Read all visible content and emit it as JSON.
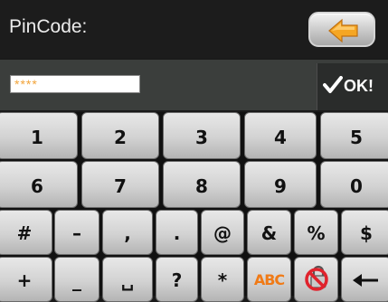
{
  "header": {
    "title": "PinCode:"
  },
  "input": {
    "value": "****"
  },
  "ok_button": {
    "label": "OK!"
  },
  "keyboard": {
    "row1": [
      "1",
      "2",
      "3",
      "4",
      "5"
    ],
    "row2": [
      "6",
      "7",
      "8",
      "9",
      "0"
    ],
    "row3": [
      "#",
      "–",
      ",",
      ".",
      "@",
      "&",
      "%",
      "$"
    ],
    "row4": [
      "+",
      "_",
      "␣",
      "?",
      "*",
      "ABC"
    ]
  },
  "colors": {
    "accent_arrow": "#f5a623",
    "input_text": "#f2a43a",
    "abc_key_text": "#f07a16"
  },
  "icons": {
    "back": "left-arrow-icon",
    "ok": "checkmark-icon",
    "nolock": "no-lock-icon",
    "backspace": "backspace-arrow-icon"
  }
}
